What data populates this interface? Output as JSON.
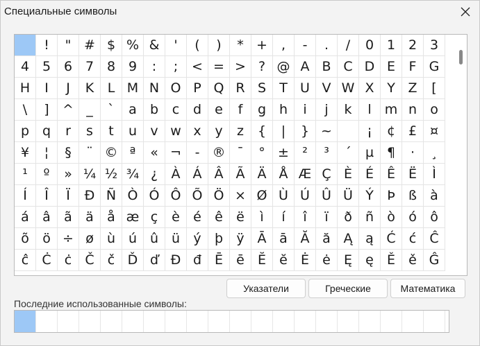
{
  "window": {
    "title": "Специальные символы"
  },
  "grid": {
    "selected_index": 0,
    "rows": [
      [
        "",
        "!",
        "\"",
        "#",
        "$",
        "%",
        "&",
        "'",
        "(",
        ")",
        "*",
        "+",
        ",",
        "-",
        ".",
        "/",
        "0",
        "1",
        "2",
        "3"
      ],
      [
        "4",
        "5",
        "6",
        "7",
        "8",
        "9",
        ":",
        ";",
        "<",
        "=",
        ">",
        "?",
        "@",
        "A",
        "B",
        "C",
        "D",
        "E",
        "F",
        "G"
      ],
      [
        "H",
        "I",
        "J",
        "K",
        "L",
        "M",
        "N",
        "O",
        "P",
        "Q",
        "R",
        "S",
        "T",
        "U",
        "V",
        "W",
        "X",
        "Y",
        "Z",
        "["
      ],
      [
        "\\",
        "]",
        "^",
        "_",
        "`",
        "a",
        "b",
        "c",
        "d",
        "e",
        "f",
        "g",
        "h",
        "i",
        "j",
        "k",
        "l",
        "m",
        "n",
        "o"
      ],
      [
        "p",
        "q",
        "r",
        "s",
        "t",
        "u",
        "v",
        "w",
        "x",
        "y",
        "z",
        "{",
        "|",
        "}",
        "~",
        "",
        "¡",
        "¢",
        "£",
        "¤"
      ],
      [
        "¥",
        "¦",
        "§",
        "¨",
        "©",
        "ª",
        "«",
        "¬",
        "-",
        "®",
        "¯",
        "°",
        "±",
        "²",
        "³",
        "´",
        "µ",
        "¶",
        "·",
        "¸"
      ],
      [
        "¹",
        "º",
        "»",
        "¼",
        "½",
        "¾",
        "¿",
        "À",
        "Á",
        "Â",
        "Ã",
        "Ä",
        "Å",
        "Æ",
        "Ç",
        "È",
        "É",
        "Ê",
        "Ë",
        "Ì"
      ],
      [
        "Í",
        "Î",
        "Ï",
        "Ð",
        "Ñ",
        "Ò",
        "Ó",
        "Ô",
        "Õ",
        "Ö",
        "×",
        "Ø",
        "Ù",
        "Ú",
        "Û",
        "Ü",
        "Ý",
        "Þ",
        "ß",
        "à"
      ],
      [
        "á",
        "â",
        "ã",
        "ä",
        "å",
        "æ",
        "ç",
        "è",
        "é",
        "ê",
        "ë",
        "ì",
        "í",
        "î",
        "ï",
        "ð",
        "ñ",
        "ò",
        "ó",
        "ô"
      ],
      [
        "õ",
        "ö",
        "÷",
        "ø",
        "ù",
        "ú",
        "û",
        "ü",
        "ý",
        "þ",
        "ÿ",
        "Ā",
        "ā",
        "Ă",
        "ă",
        "Ą",
        "ą",
        "Ć",
        "ć",
        "Ĉ"
      ],
      [
        "ĉ",
        "Ċ",
        "ċ",
        "Č",
        "č",
        "Ď",
        "ď",
        "Đ",
        "đ",
        "Ē",
        "ē",
        "Ĕ",
        "ĕ",
        "Ė",
        "ė",
        "Ę",
        "ę",
        "Ě",
        "ě",
        "Ĝ"
      ]
    ]
  },
  "buttons": {
    "pointers": "Указатели",
    "greek": "Греческие",
    "math": "Математика"
  },
  "recent": {
    "label": "Последние использованные символы:",
    "items": [
      "",
      "",
      "",
      "",
      "",
      "",
      "",
      "",
      "",
      "",
      "",
      "",
      "",
      "",
      "",
      "",
      "",
      "",
      "",
      ""
    ],
    "selected_index": 0
  }
}
